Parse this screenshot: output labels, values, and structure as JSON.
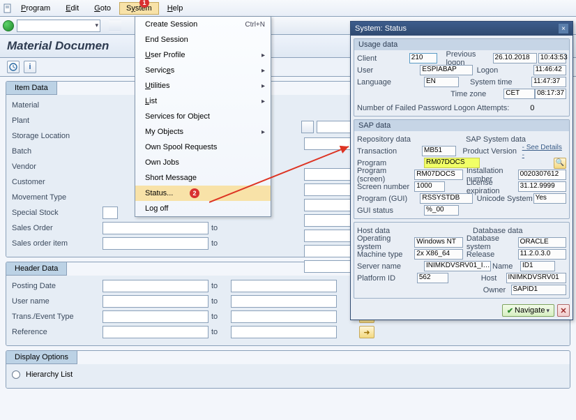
{
  "menu": {
    "program": "Program",
    "edit": "Edit",
    "goto": "Goto",
    "system": "System",
    "help": "Help"
  },
  "annot": {
    "badge1": "1",
    "badge2": "2"
  },
  "title": "Material Documen",
  "dropdown": {
    "create_session": "Create Session",
    "create_session_sc": "Ctrl+N",
    "end_session": "End Session",
    "user_profile": "User Profile",
    "services": "Services",
    "utilities": "Utilities",
    "list": "List",
    "services_for_object": "Services for Object",
    "my_objects": "My Objects",
    "own_spool": "Own Spool Requests",
    "own_jobs": "Own Jobs",
    "short_message": "Short Message",
    "status": "Status...",
    "log_off": "Log off"
  },
  "item_data": {
    "tab": "Item Data",
    "material": "Material",
    "plant": "Plant",
    "sloc": "Storage Location",
    "batch": "Batch",
    "vendor": "Vendor",
    "customer": "Customer",
    "mvt": "Movement Type",
    "spec": "Special Stock",
    "sales": "Sales Order",
    "sitem": "Sales order item",
    "to": "to"
  },
  "header_data": {
    "tab": "Header Data",
    "posting": "Posting Date",
    "username": "User name",
    "trans": "Trans./Event Type",
    "ref": "Reference",
    "to": "to"
  },
  "display_options": {
    "tab": "Display Options",
    "hier": "Hierarchy List"
  },
  "status_win": {
    "title": "System: Status",
    "usage": {
      "head": "Usage data",
      "client": "Client",
      "client_v": "210",
      "user": "User",
      "user_v": "ESPIABAP",
      "lang": "Language",
      "lang_v": "EN",
      "prev": "Previous logon",
      "prev_d": "26.10.2018",
      "prev_t": "10:43:53",
      "logon": "Logon",
      "logon_t": "11:46:42",
      "systime": "System time",
      "systime_t": "11:47:37",
      "tz": "Time zone",
      "tz_v": "CET",
      "tz_t": "08:17:37",
      "failed": "Number of Failed Password Logon Attempts:",
      "failed_v": "0"
    },
    "sap": {
      "head": "SAP data",
      "repo": "Repository data",
      "sys": "SAP System data",
      "tx": "Transaction",
      "tx_v": "MB51",
      "prg": "Program",
      "prg_v": "RM07DOCS",
      "pscr": "Program (screen)",
      "pscr_v": "RM07DOCS",
      "scr": "Screen number",
      "scr_v": "1000",
      "pgui": "Program (GUI)",
      "pgui_v": "RSSYSTDB",
      "gui": "GUI status",
      "gui_v": "%_00",
      "pver": "Product Version",
      "see": "- See Details -",
      "inst": "Installation number",
      "inst_v": "0020307612",
      "lic": "License expiration",
      "lic_v": "31.12.9999",
      "uni": "Unicode System",
      "uni_v": "Yes"
    },
    "host": {
      "head_h": "Host data",
      "head_d": "Database data",
      "os": "Operating system",
      "os_v": "Windows NT",
      "mt": "Machine type",
      "mt_v": "2x X86_64",
      "srv": "Server name",
      "srv_v": "INIMKDVSRV01_I…",
      "plat": "Platform ID",
      "plat_v": "562",
      "dbsys": "Database system",
      "dbsys_v": "ORACLE",
      "rel": "Release",
      "rel_v": "11.2.0.3.0",
      "name": "Name",
      "name_v": "ID1",
      "hostl": "Host",
      "host_v": "INIMKDVSRV01",
      "own": "Owner",
      "own_v": "SAPID1"
    },
    "nav": "Navigate"
  }
}
